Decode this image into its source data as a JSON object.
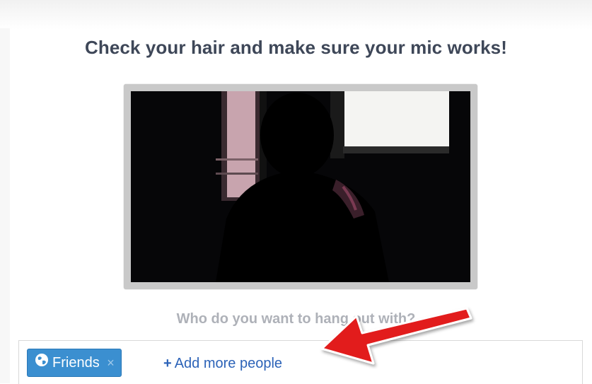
{
  "headline": "Check your hair and make sure your mic works!",
  "preview": {
    "icon": "camera-preview"
  },
  "question": "Who do you want to hang out with?",
  "circle_chip": {
    "label": "Friends",
    "icon": "globe-icon",
    "remove": "×"
  },
  "add_people": {
    "plus": "+",
    "label": "Add more people"
  },
  "colors": {
    "accent": "#3b8fd0",
    "link": "#2c63b8",
    "headline": "#3e4758",
    "annotation": "#e21f1f"
  }
}
